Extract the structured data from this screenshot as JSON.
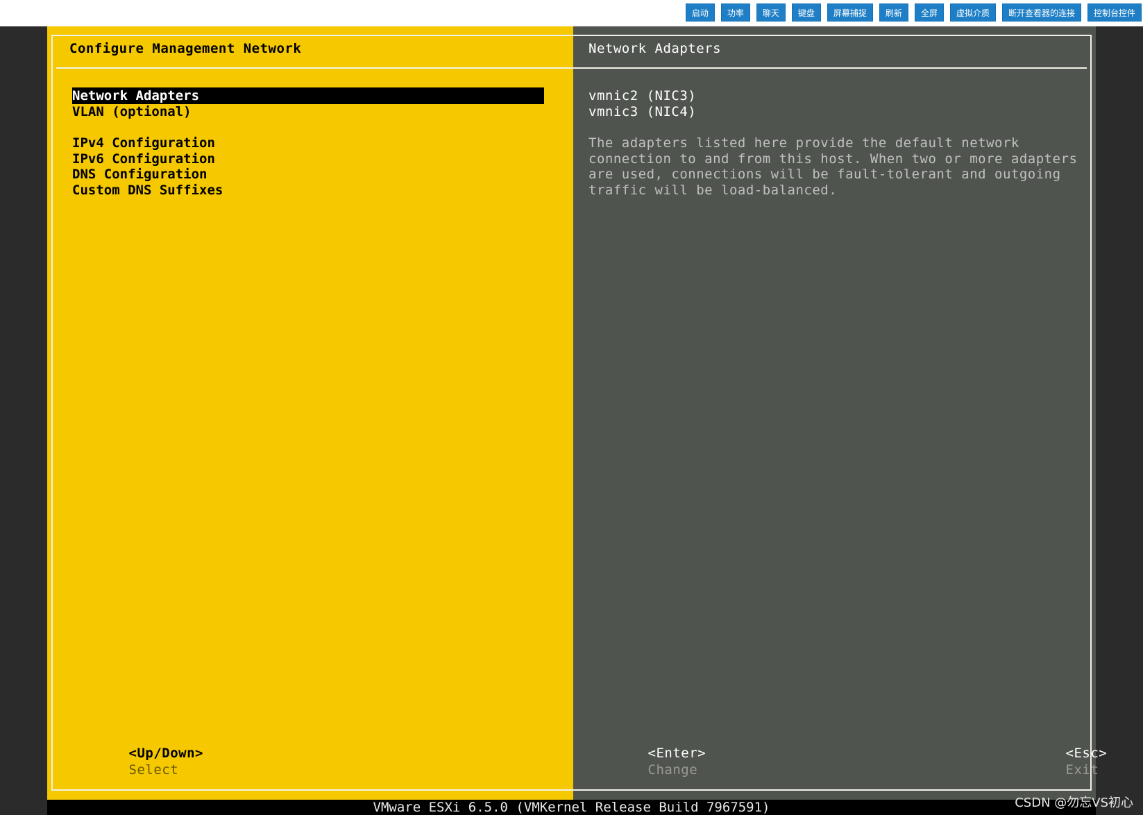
{
  "toolbar": {
    "buttons": [
      "启动",
      "功率",
      "聊天",
      "键盘",
      "屏幕捕捉",
      "刷新",
      "全屏",
      "虚拟介质",
      "断开查看器的连接",
      "控制台控件"
    ]
  },
  "left_pane": {
    "title": "Configure Management Network",
    "menu": [
      "Network Adapters",
      "VLAN (optional)",
      "IPv4 Configuration",
      "IPv6 Configuration",
      "DNS Configuration",
      "Custom DNS Suffixes"
    ],
    "selected_index": 0,
    "footer_key": "<Up/Down>",
    "footer_action": "Select"
  },
  "right_pane": {
    "title": "Network Adapters",
    "adapters": [
      "vmnic2 (NIC3)",
      "vmnic3 (NIC4)"
    ],
    "description": [
      "The adapters listed here provide the default network",
      "connection to and from this host. When two or more adapters",
      "are used, connections will be fault-tolerant and outgoing",
      "traffic will be load-balanced."
    ],
    "enter_key": "<Enter>",
    "enter_action": "Change",
    "esc_key": "<Esc>",
    "esc_action": "Exit"
  },
  "status_bar": "VMware ESXi 6.5.0 (VMKernel Release Build 7967591)",
  "watermark": "CSDN @勿忘VS初心",
  "colors": {
    "left_bg": "#f5c800",
    "right_bg": "#50544f",
    "toolbar_button": "#1f7fc6"
  }
}
